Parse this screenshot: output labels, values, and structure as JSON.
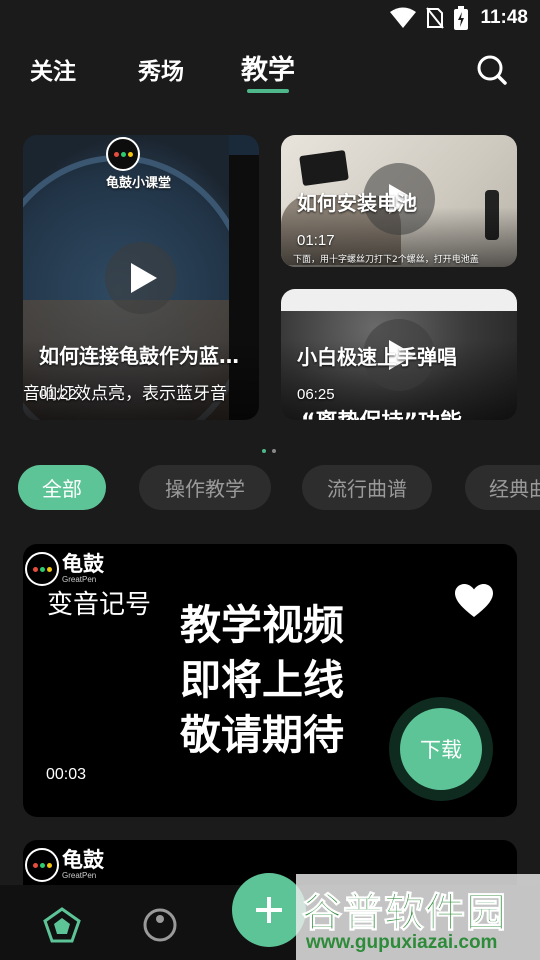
{
  "status_bar": {
    "time": "11:48",
    "icons": [
      "wifi-icon",
      "no-sim-icon",
      "battery-charging-icon"
    ]
  },
  "top_nav": {
    "tabs": [
      {
        "label": "关注",
        "active": false
      },
      {
        "label": "秀场",
        "active": false
      },
      {
        "label": "教学",
        "active": true
      }
    ],
    "search_icon": "search-icon"
  },
  "featured": [
    {
      "title": "如何连接龟鼓作为蓝…",
      "duration": "01:22",
      "brand": "龟鼓小课堂",
      "caption": "音响灯效点亮，表示蓝牙音"
    },
    {
      "title": "如何安装电池",
      "duration": "01:17",
      "caption": "下面，用十字螺丝刀打下2个螺丝，打开电池盖"
    },
    {
      "title": "小白极速上手弹唱",
      "duration": "06:25",
      "caption": "“离势保持”功能"
    }
  ],
  "pager": {
    "count": 2,
    "active": 0
  },
  "chips": [
    {
      "label": "全部",
      "active": true
    },
    {
      "label": "操作教学",
      "active": false
    },
    {
      "label": "流行曲谱",
      "active": false
    },
    {
      "label": "经典曲谱",
      "active": false
    }
  ],
  "cards": [
    {
      "logo_text": "龟鼓",
      "logo_sub": "GreatPen",
      "series": "变音记号",
      "message": [
        "教学视频",
        "即将上线",
        "敬请期待"
      ],
      "duration": "00:03",
      "download_label": "下载",
      "favorited": true
    },
    {
      "logo_text": "龟鼓",
      "logo_sub": "GreatPen"
    }
  ],
  "bottom_nav": {
    "items": [
      "home-pentagon-icon",
      "drum-icon",
      "add-icon",
      "message-icon",
      "profile-icon"
    ],
    "accent": "#5dc497"
  },
  "watermark": {
    "main": "谷普软件园",
    "url": "www.gupuxiazai.com"
  },
  "colors": {
    "background": "#1b1b1b",
    "accent": "#5dc497",
    "chip_bg": "#2d2d2d",
    "card_bg": "#000000"
  }
}
